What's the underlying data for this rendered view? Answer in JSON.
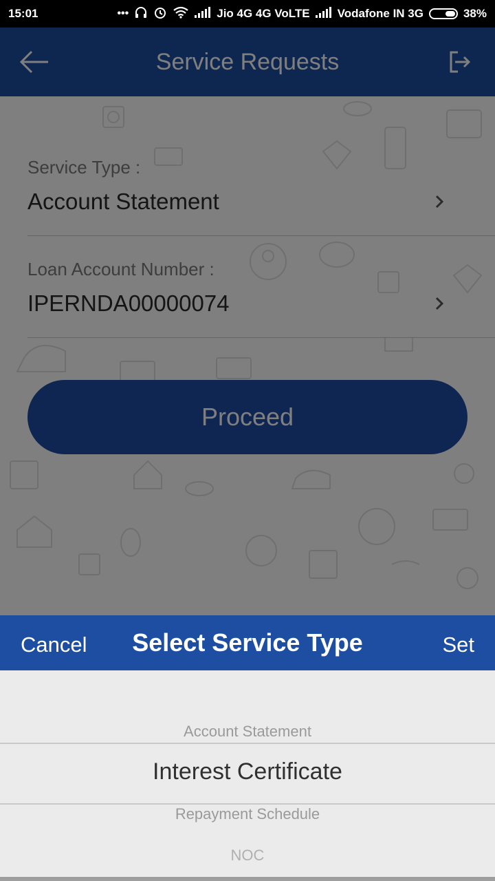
{
  "status_bar": {
    "time": "15:01",
    "carrier1": "Jio 4G 4G VoLTE",
    "carrier2": "Vodafone IN 3G",
    "battery": "38%"
  },
  "header": {
    "title": "Service Requests",
    "back_icon": "arrow-left-icon",
    "logout_icon": "logout-icon",
    "color": "#1d4ea2"
  },
  "form": {
    "service_type": {
      "label": "Service Type :",
      "value": "Account Statement"
    },
    "loan_account": {
      "label": "Loan Account Number :",
      "value": "IPERNDA00000074"
    },
    "proceed_label": "Proceed"
  },
  "picker": {
    "cancel_label": "Cancel",
    "title": "Select Service Type",
    "set_label": "Set",
    "options": [
      "Account Statement",
      "Interest Certificate",
      "Repayment Schedule",
      "NOC"
    ],
    "selected": "Interest Certificate"
  }
}
